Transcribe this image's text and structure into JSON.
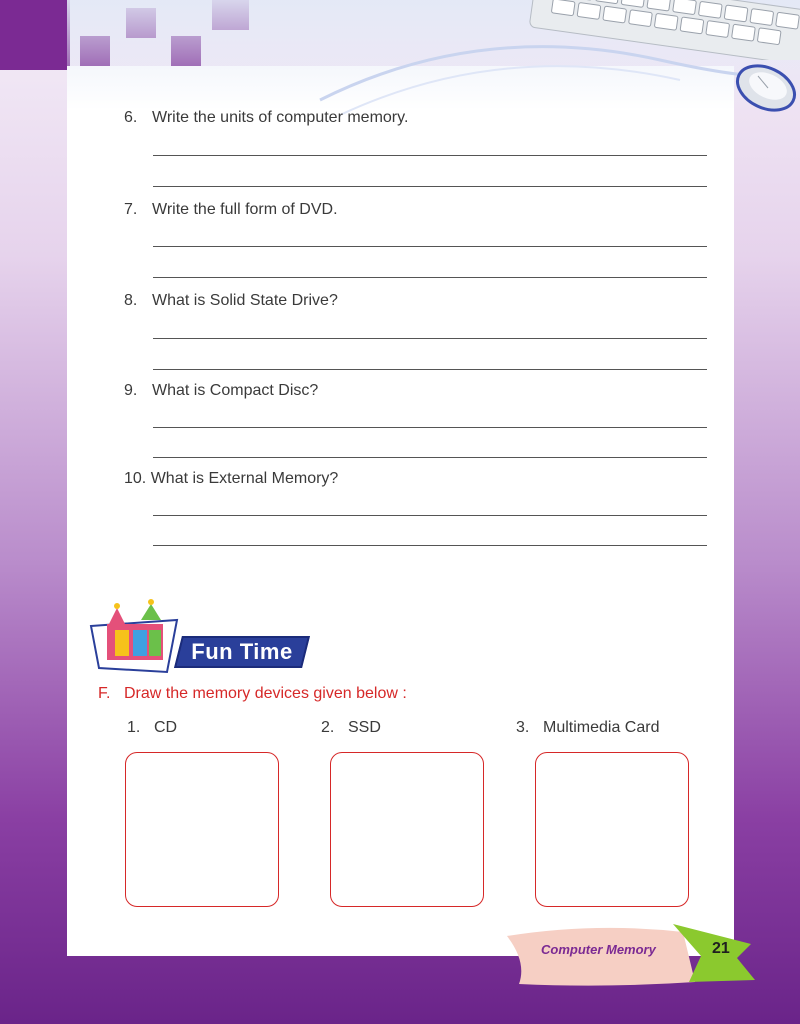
{
  "questions": [
    {
      "num": "6.",
      "text": "Write the units of computer memory."
    },
    {
      "num": "7.",
      "text": "Write the full form of DVD."
    },
    {
      "num": "8.",
      "text": "What is Solid State Drive?"
    },
    {
      "num": "9.",
      "text": "What is Compact Disc?"
    },
    {
      "num": "10.",
      "text": "What is External Memory?"
    }
  ],
  "fun_time": {
    "label": "Fun Time"
  },
  "section_f": {
    "letter": "F.",
    "instruction": "Draw the memory devices given below :"
  },
  "devices": [
    {
      "num": "1.",
      "name": "CD"
    },
    {
      "num": "2.",
      "name": "SSD"
    },
    {
      "num": "3.",
      "name": "Multimedia Card"
    }
  ],
  "footer": {
    "chapter": "Computer Memory",
    "page_number": "21"
  },
  "colors": {
    "accent_red": "#d62828",
    "purple": "#7b2a93",
    "banner_blue": "#2a3f9a",
    "footer_green": "#8bc92e"
  }
}
